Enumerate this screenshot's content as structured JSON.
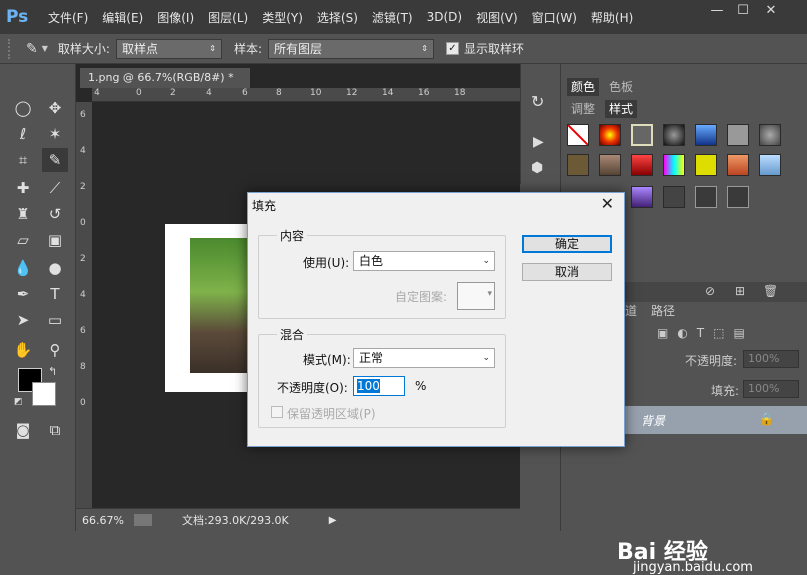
{
  "menubar": {
    "logo": "Ps",
    "items": [
      "文件(F)",
      "编辑(E)",
      "图像(I)",
      "图层(L)",
      "类型(Y)",
      "选择(S)",
      "滤镜(T)",
      "3D(D)",
      "视图(V)",
      "窗口(W)",
      "帮助(H)"
    ],
    "min": "—",
    "max": "☐",
    "close": "✕"
  },
  "options": {
    "sample_size_label": "取样大小:",
    "sample_size_value": "取样点",
    "sample_label": "样本:",
    "sample_value": "所有图层",
    "show_ring_label": "显示取样环",
    "show_ring_checked": "✓"
  },
  "document": {
    "tab_label": "1.png @ 66.7%(RGB/8#) *",
    "tab_close": "✕",
    "ruler_top": [
      "4",
      "0",
      "2",
      "4",
      "6",
      "8",
      "10",
      "12",
      "14",
      "16",
      "18"
    ],
    "ruler_left": [
      "6",
      "4",
      "2",
      "0",
      "2",
      "4",
      "6",
      "8",
      "0"
    ],
    "zoom": "66.67%",
    "doc_info": "文档:293.0K/293.0K"
  },
  "panels": {
    "color_tab": "颜色",
    "swatches_tab": "色板",
    "adjust_tab": "调整",
    "styles_tab": "样式",
    "channels_tab": "道",
    "paths_tab": "路径",
    "opacity_label": "不透明度:",
    "opacity_value": "100%",
    "fill_label": "填充:",
    "fill_value": "100%",
    "layer_name": "背景"
  },
  "dialog": {
    "title": "填充",
    "close": "✕",
    "contents_group": "内容",
    "use_label": "使用(U):",
    "use_value": "白色",
    "custom_pattern_label": "自定图案:",
    "blending_group": "混合",
    "mode_label": "模式(M):",
    "mode_value": "正常",
    "opacity_label": "不透明度(O):",
    "opacity_value": "100",
    "opacity_unit": "%",
    "preserve_label": "保留透明区域(P)",
    "ok_label": "确定",
    "cancel_label": "取消"
  },
  "watermark": {
    "text": "Bai 经验",
    "url": "jingyan.baidu.com"
  },
  "colors": {
    "accent": "#0078d7",
    "ps_blue": "#6cb5f5",
    "dark_bg": "#282828"
  }
}
